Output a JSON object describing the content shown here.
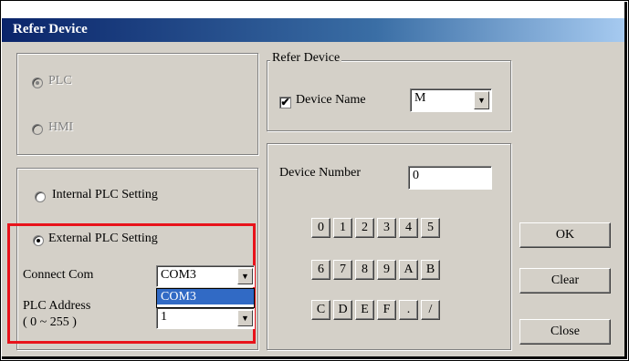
{
  "window": {
    "title": "Refer Device"
  },
  "target_group": {
    "plc_label": "PLC",
    "hmi_label": "HMI",
    "selected": "PLC",
    "disabled": true
  },
  "plc_setting": {
    "internal_label": "Internal PLC Setting",
    "external_label": "External PLC Setting",
    "selected": "External PLC Setting",
    "connect_com_label": "Connect Com",
    "connect_com_value": "COM3",
    "connect_com_options": [
      "COM3"
    ],
    "plc_address_label": "PLC Address",
    "plc_address_range": "( 0 ~ 255 )",
    "plc_address_value": "1"
  },
  "refer_device": {
    "group_title": "Refer Device",
    "device_name_label": "Device Name",
    "device_name_checked": true,
    "device_name_value": "M",
    "checkmark": "✔"
  },
  "device_number": {
    "label": "Device Number",
    "value": "0",
    "keypad_rows": [
      [
        "0",
        "1",
        "2",
        "3",
        "4",
        "5"
      ],
      [
        "6",
        "7",
        "8",
        "9",
        "A",
        "B"
      ],
      [
        "C",
        "D",
        "E",
        "F",
        ".",
        "/"
      ]
    ]
  },
  "buttons": {
    "ok": "OK",
    "clear": "Clear",
    "close": "Close"
  },
  "icons": {
    "dropdown_arrow": "▼"
  },
  "colors": {
    "highlight": "#e8131b",
    "titlebar": "#0a246a",
    "selection": "#316ac5"
  }
}
